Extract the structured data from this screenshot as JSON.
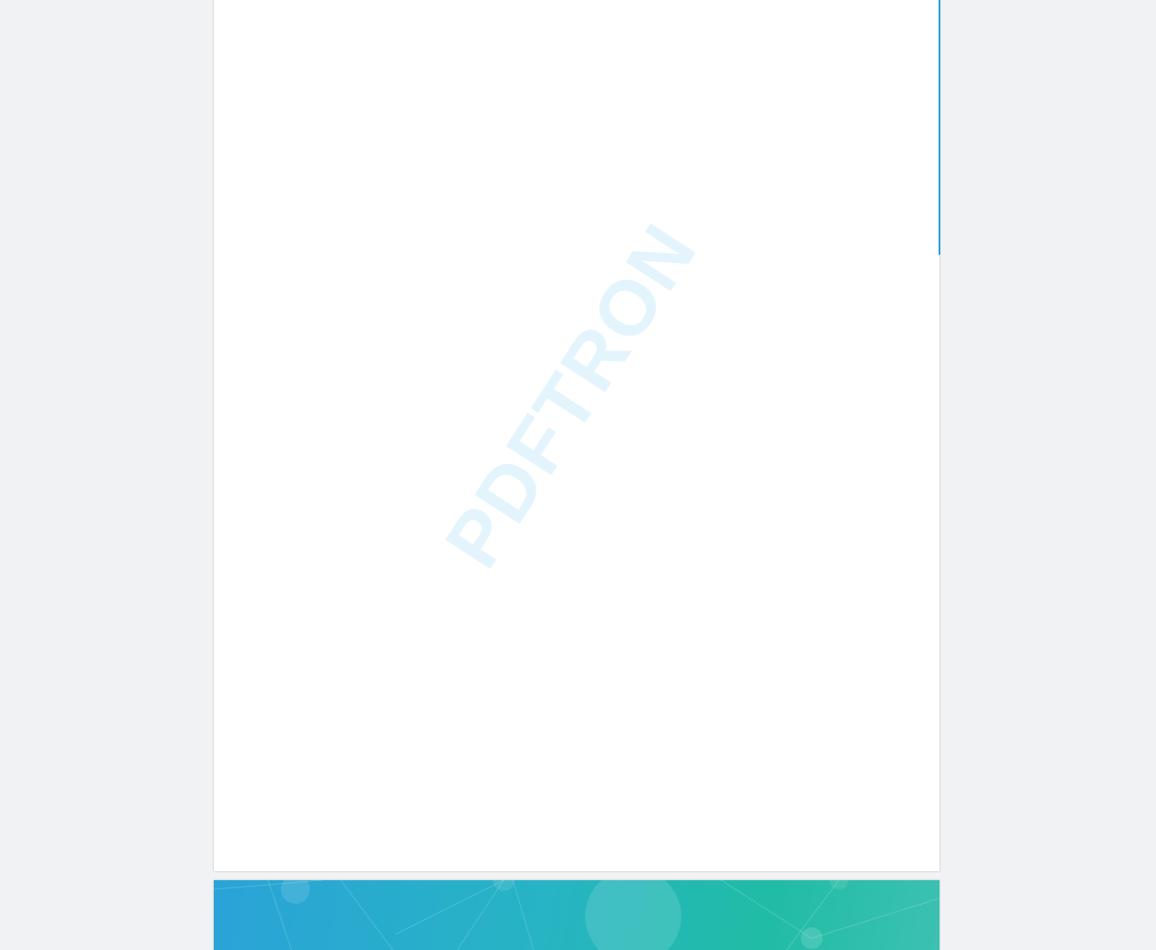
{
  "document": {
    "watermark_text": "PDFTRON",
    "watermark_color": "#e3f4fc",
    "scroll_accent": "#2a9fd6",
    "background_color": "#f1f2f4",
    "page_count_visible": 2
  }
}
